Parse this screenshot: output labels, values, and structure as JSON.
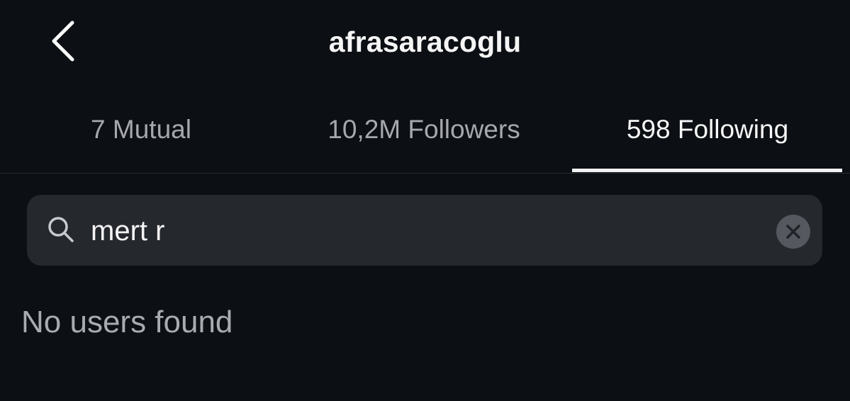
{
  "header": {
    "back_icon": "chevron-left-icon",
    "username": "afrasaracoglu"
  },
  "tabs": [
    {
      "label": "7 Mutual",
      "active": false
    },
    {
      "label": "10,2M Followers",
      "active": false
    },
    {
      "label": "598 Following",
      "active": true
    }
  ],
  "search": {
    "icon": "search-icon",
    "value": "mert r",
    "placeholder": "Search",
    "clear_icon": "clear-icon"
  },
  "results": {
    "empty_message": "No users found"
  },
  "colors": {
    "background": "#0c0f14",
    "search_background": "#25282d",
    "muted_text": "#a6a8ad",
    "active_text": "#f7f7f7"
  }
}
